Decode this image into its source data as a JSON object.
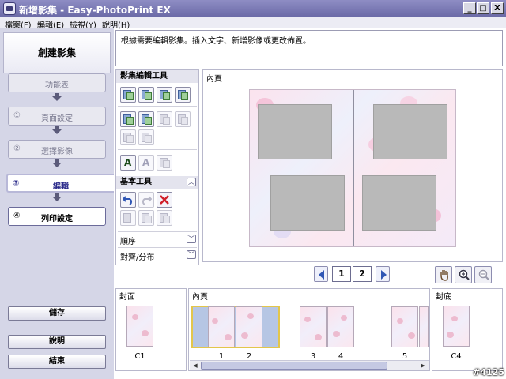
{
  "window": {
    "title": "新增影集 - Easy-PhotoPrint EX",
    "controls": {
      "minimize": "_",
      "maximize": "□",
      "close": "X"
    }
  },
  "menu": [
    "檔案(F)",
    "編輯(E)",
    "檢視(Y)",
    "說明(H)"
  ],
  "sidebar": {
    "title": "創建影集",
    "steps": [
      {
        "num": "",
        "label": "功能表"
      },
      {
        "num": "①",
        "label": "頁面設定"
      },
      {
        "num": "②",
        "label": "選擇影像"
      },
      {
        "num": "③",
        "label": "編輯"
      },
      {
        "num": "④",
        "label": "列印設定"
      }
    ],
    "save_label": "儲存",
    "help_label": "說明",
    "exit_label": "結束"
  },
  "instruction": "根據需要編輯影集。插入文字、新增影像或更改佈置。",
  "tools": {
    "album_tools_title": "影集編輯工具",
    "basic_tools_title": "基本工具",
    "order_label": "順序",
    "align_label": "對齊/分布"
  },
  "pageview": {
    "label": "內頁",
    "page_numbers": [
      "1",
      "2"
    ]
  },
  "strip": {
    "cover_label": "封面",
    "inner_label": "內頁",
    "back_label": "封底",
    "captions": {
      "c1": "C1",
      "p1": "1",
      "p2": "2",
      "p3": "3",
      "p4": "4",
      "p5": "5",
      "c4": "C4"
    }
  },
  "icons": {
    "app": "app-icon",
    "prev": "chevron-left-icon",
    "next": "chevron-right-icon",
    "hand": "hand-tool-icon",
    "zoom_in": "zoom-in-icon",
    "zoom_out": "zoom-out-icon"
  },
  "colors": {
    "titlebar": "#7c7bb6",
    "sidebar_bg": "#d5d6e7",
    "selection_border": "#e3c64a",
    "nav_blue": "#2f56b5",
    "delete_red": "#d0202a"
  },
  "watermark": "#4125"
}
